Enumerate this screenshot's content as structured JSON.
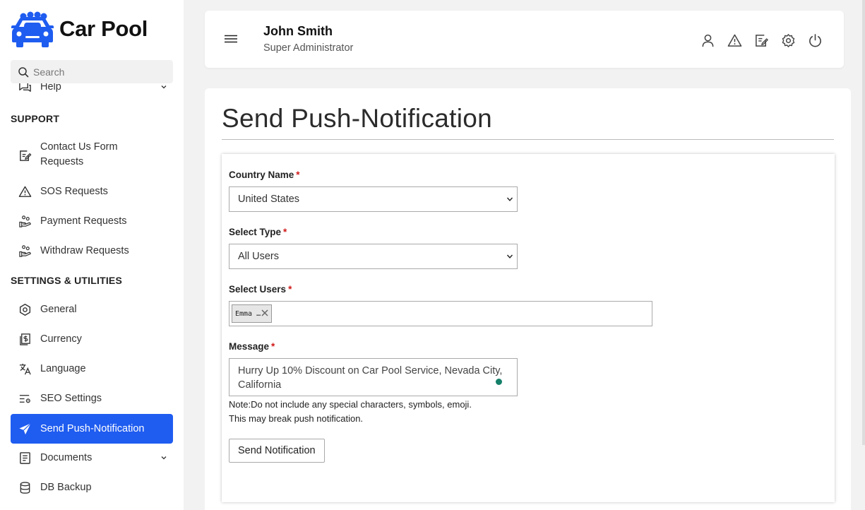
{
  "brand": {
    "name": "Car Pool"
  },
  "search": {
    "placeholder": "Search"
  },
  "sidebar": {
    "partial_item": "Help",
    "sections": {
      "support": "SUPPORT",
      "settings": "SETTINGS & UTILITIES"
    },
    "items": {
      "contact_line1": "Contact Us Form",
      "contact_line2": "Requests",
      "sos": "SOS Requests",
      "payment": "Payment Requests",
      "withdraw": "Withdraw Requests",
      "general": "General",
      "currency": "Currency",
      "language": "Language",
      "seo": "SEO Settings",
      "push": "Send Push-Notification",
      "documents": "Documents",
      "db_backup": "DB Backup"
    },
    "active_color": "#1f5cf0"
  },
  "header": {
    "user_name": "John Smith",
    "user_role": "Super Administrator"
  },
  "page": {
    "title": "Send Push-Notification"
  },
  "form": {
    "country_label": "Country Name",
    "country_value": "United States",
    "type_label": "Select Type",
    "type_value": "All Users",
    "users_label": "Select Users",
    "users_selected": [
      "Emma …"
    ],
    "message_label": "Message",
    "message_value": "Hurry Up 10% Discount on Car Pool Service, Nevada City, California",
    "note_line1": "Note:Do not include any special characters, symbols, emoji.",
    "note_line2": "This may break push notification.",
    "submit_label": "Send Notification",
    "required_mark": "*"
  }
}
